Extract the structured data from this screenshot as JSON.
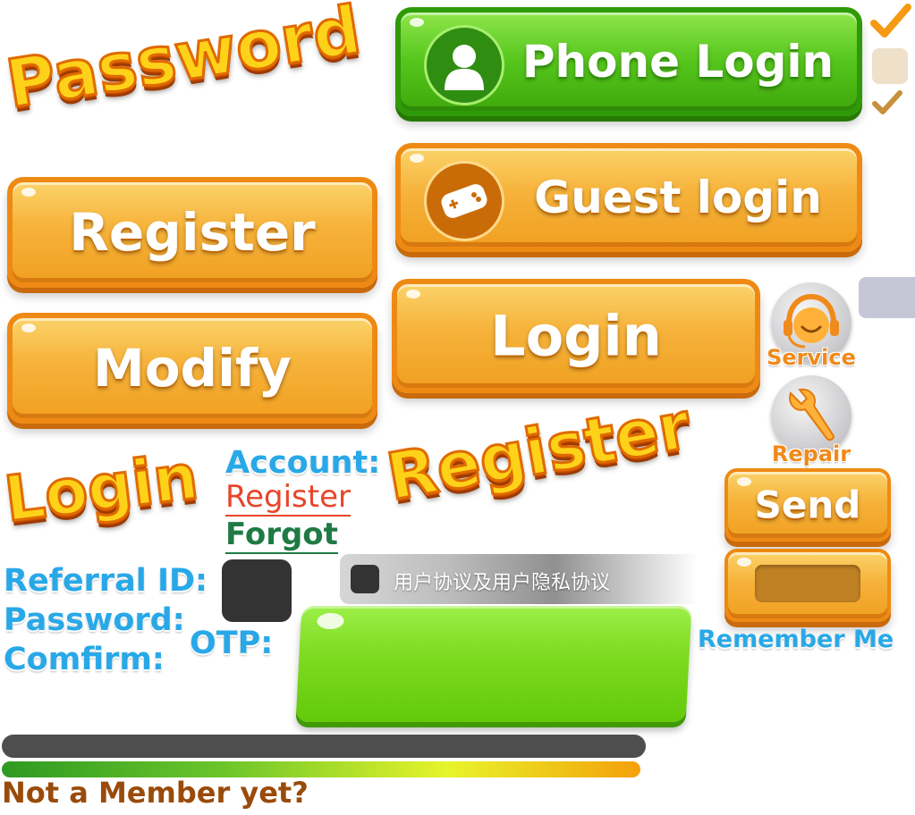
{
  "titles": {
    "password": "Password",
    "login": "Login",
    "register": "Register"
  },
  "buttons": {
    "phone_login": "Phone Login",
    "guest_login": "Guest login",
    "register": "Register",
    "modify": "Modify",
    "login": "Login",
    "send": "Send"
  },
  "icons": {
    "service_label": "Service",
    "repair_label": "Repair",
    "user": "user-silhouette-icon",
    "gamepad": "handheld-console-icon",
    "headset": "headset-service-icon",
    "wrench": "wrench-repair-icon",
    "checkmark": "checkmark-icon"
  },
  "links": {
    "account": "Account:",
    "register": "Register",
    "forgot": "Forgot"
  },
  "form_labels": {
    "referral_id": "Referral ID:",
    "password": "Password:",
    "confirm": "Comfirm:",
    "otp": "OTP:",
    "remember_me": "Remember Me"
  },
  "agreement": {
    "text": "用户协议及用户隐私协议"
  },
  "footer": {
    "not_member": "Not a Member yet?"
  },
  "progress": {
    "fill_fraction": 1.0
  },
  "colors": {
    "orange": "#f6b23a",
    "green": "#55c51c",
    "blue_label": "#29a8e8",
    "link_red": "#e8452a",
    "link_green": "#1f7a45",
    "footer_brown": "#9a4b0a"
  }
}
